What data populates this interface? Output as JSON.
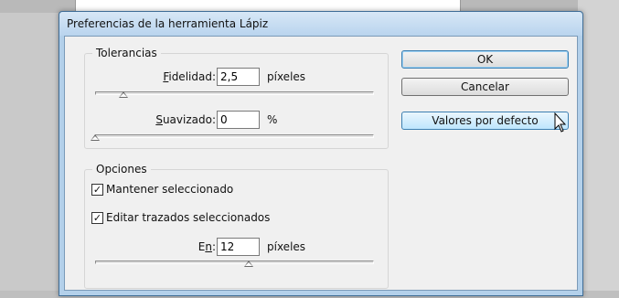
{
  "window": {
    "title": "Preferencias de la herramienta Lápiz"
  },
  "tolerances": {
    "legend": "Tolerancias",
    "fidelity": {
      "label_u": "F",
      "label_rest": "idelidad:",
      "value": "2,5",
      "unit": "píxeles",
      "slider_fraction": 0.1
    },
    "smoothing": {
      "label_u": "S",
      "label_rest": "uavizado:",
      "value": "0",
      "unit": "%",
      "slider_fraction": 0.0
    }
  },
  "options": {
    "legend": "Opciones",
    "keep_selected": {
      "label": "Mantener seleccionado",
      "checked": true
    },
    "edit_paths": {
      "label": "Editar trazados seleccionados",
      "checked": true
    },
    "within": {
      "label_pre": "E",
      "label_u": "n",
      "label_post": ":",
      "value": "12",
      "unit": "píxeles",
      "slider_fraction": 0.55
    }
  },
  "buttons": {
    "ok": "OK",
    "cancel": "Cancelar",
    "defaults": "Valores por defecto"
  },
  "icons": {
    "check": "✓"
  }
}
